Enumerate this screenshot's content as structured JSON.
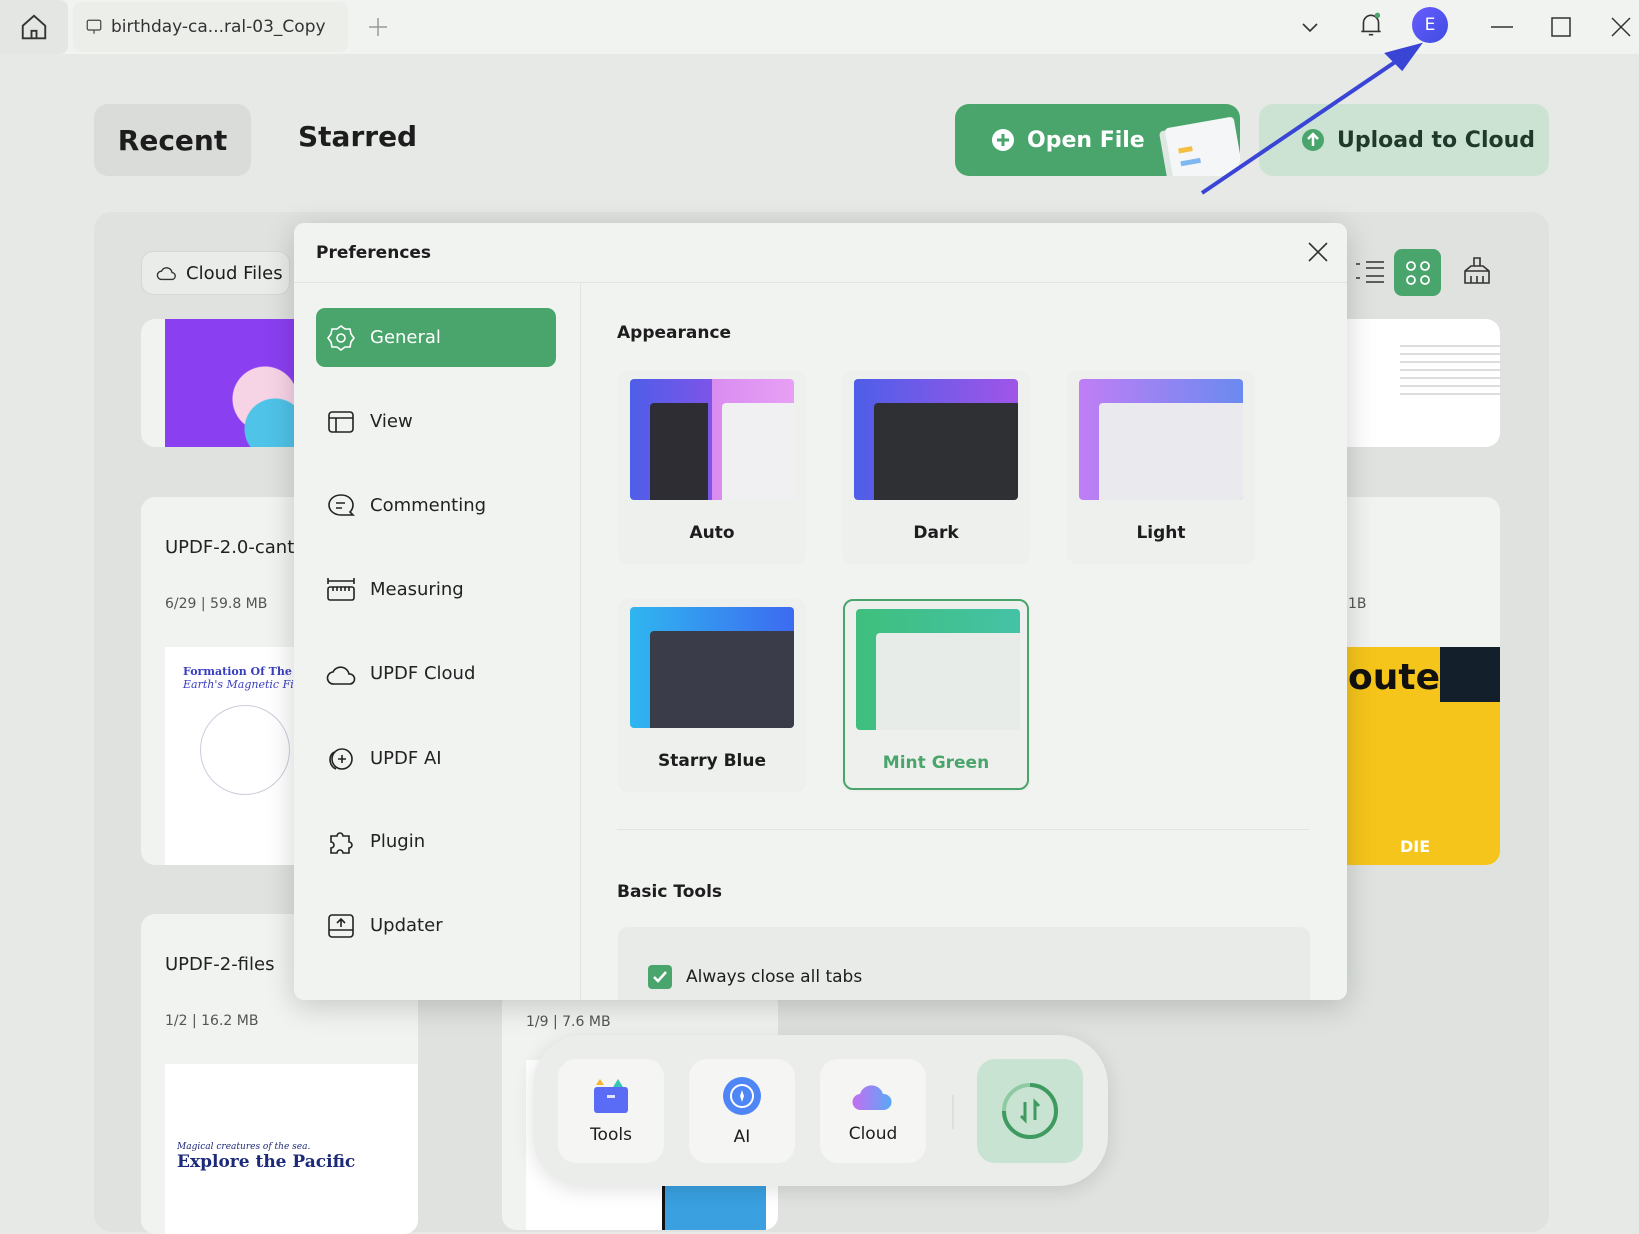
{
  "titlebar": {
    "tab_title": "birthday-ca...ral-03_Copy",
    "avatar_letter": "E",
    "icons": [
      "home-icon",
      "presentation-icon",
      "plus-icon",
      "chevron-down-icon",
      "bell-icon",
      "minimize-icon",
      "maximize-icon",
      "close-icon"
    ]
  },
  "header": {
    "tabs": [
      {
        "label": "Recent",
        "active": true
      },
      {
        "label": "Starred",
        "active": false
      }
    ],
    "open_file": "Open File",
    "upload_cloud": "Upload to Cloud"
  },
  "files": {
    "cloud_files": "Cloud Files",
    "cards": [
      {
        "title": "UPDF-2.0-cant-",
        "meta": "6/29 | 59.8 MB",
        "thumb_title": "Formation Of The",
        "thumb_subtitle": "Earth's Magnetic Field"
      },
      {
        "title": "UPDF-2-files",
        "meta": "1/2 | 16.2 MB",
        "thumb_title": "Explore the Pacific",
        "thumb_subtitle": "Magical creatures of the sea."
      },
      {
        "meta": "1/9 | 7.6 MB"
      },
      {
        "meta": "1B",
        "thumb_title": "outer",
        "thumb_subtitle": "DIE"
      }
    ]
  },
  "preferences": {
    "title": "Preferences",
    "nav": [
      {
        "label": "General",
        "icon": "gear-icon",
        "active": true
      },
      {
        "label": "View",
        "icon": "layout-icon"
      },
      {
        "label": "Commenting",
        "icon": "comment-icon"
      },
      {
        "label": "Measuring",
        "icon": "ruler-icon"
      },
      {
        "label": "UPDF Cloud",
        "icon": "cloud-icon"
      },
      {
        "label": "UPDF AI",
        "icon": "ai-icon"
      },
      {
        "label": "Plugin",
        "icon": "puzzle-icon"
      },
      {
        "label": "Updater",
        "icon": "update-icon"
      }
    ],
    "appearance": {
      "heading": "Appearance",
      "themes": [
        {
          "label": "Auto"
        },
        {
          "label": "Dark"
        },
        {
          "label": "Light"
        },
        {
          "label": "Starry Blue"
        },
        {
          "label": "Mint Green",
          "selected": true
        }
      ]
    },
    "basic_tools": {
      "heading": "Basic Tools",
      "always_close_tabs": {
        "label": "Always close all tabs",
        "checked": true
      }
    }
  },
  "dock": {
    "items": [
      {
        "label": "Tools"
      },
      {
        "label": "AI"
      },
      {
        "label": "Cloud"
      }
    ],
    "sync": "sync-icon"
  },
  "colors": {
    "accent": "#4aa56c",
    "accent_light": "#cce3d3",
    "arrow": "#3a45d6"
  }
}
